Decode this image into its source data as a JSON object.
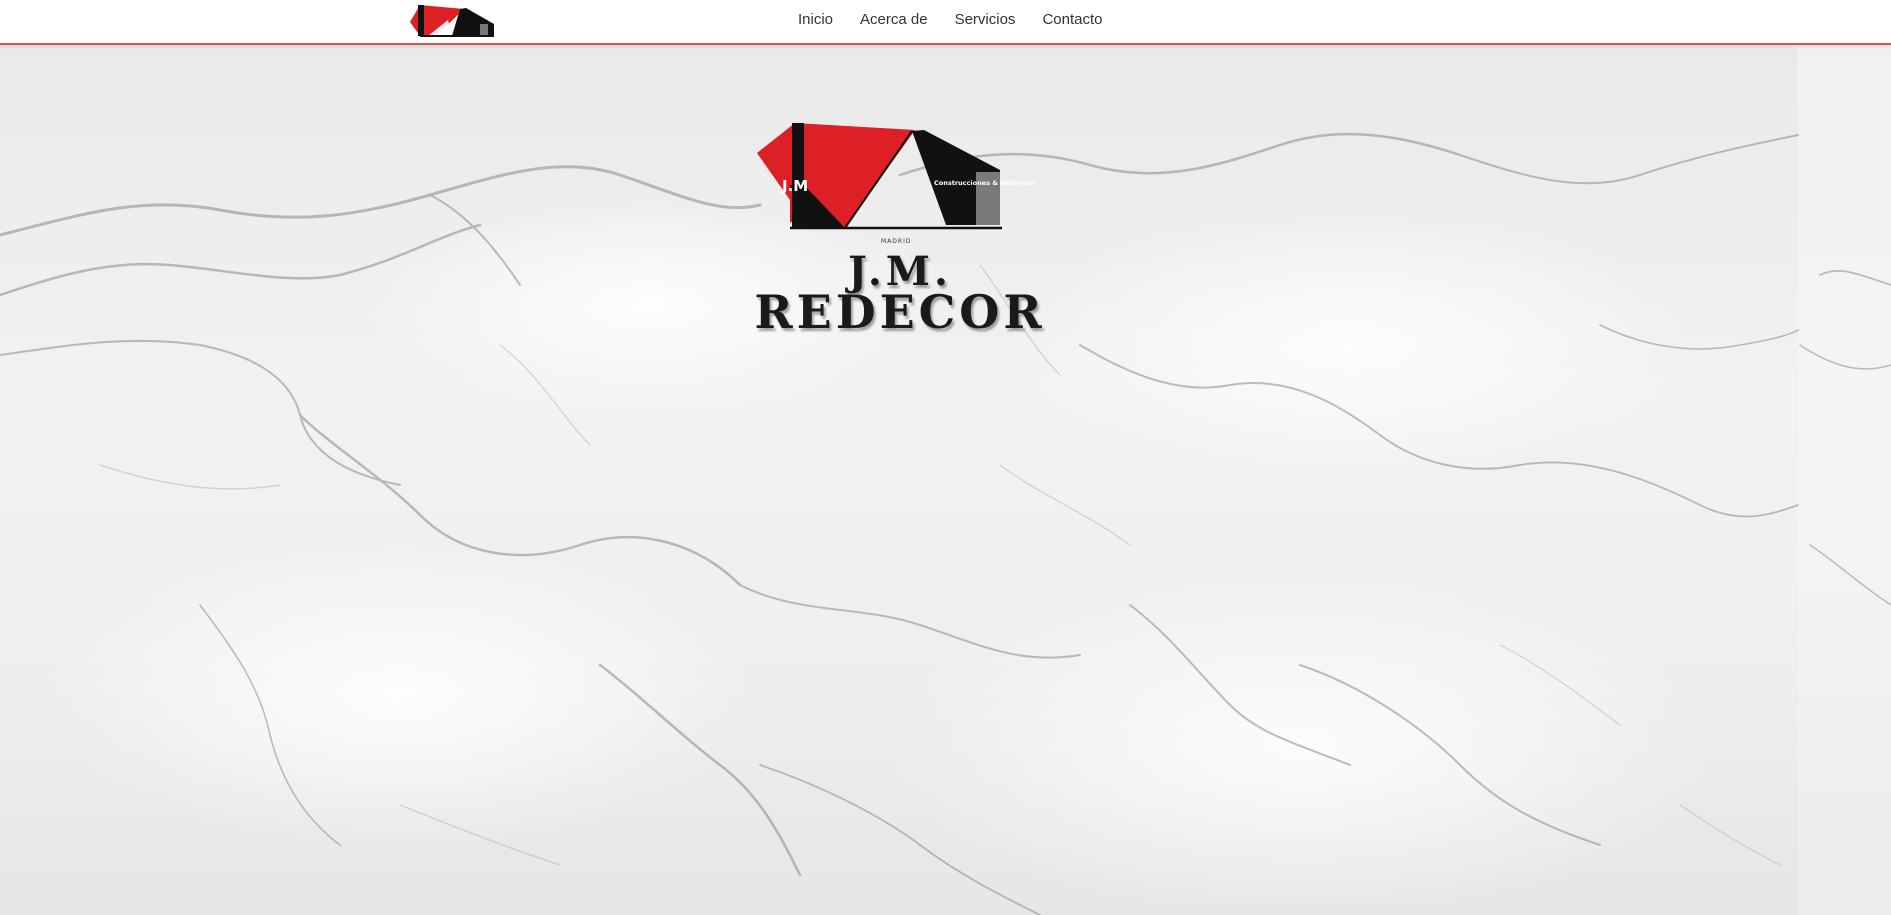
{
  "brand": {
    "logo_tagline": "Construcciones & Reformas",
    "logo_location": "MADRID",
    "logo_monogram": "J.M"
  },
  "nav": {
    "items": [
      {
        "label": "Inicio"
      },
      {
        "label": "Acerca de"
      },
      {
        "label": "Servicios"
      },
      {
        "label": "Contacto"
      }
    ]
  },
  "hero": {
    "title_line1": "J.M.",
    "title_line2": "REDECOR"
  },
  "colors": {
    "accent_red": "#dd1f26",
    "nav_border": "#e0524c",
    "text_dark": "#1a1a1a"
  }
}
